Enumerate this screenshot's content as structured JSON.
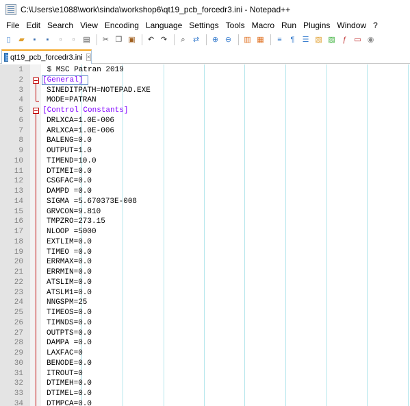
{
  "window": {
    "title": "C:\\Users\\e1088\\work\\sinda\\workshop6\\qt19_pcb_forcedr3.ini - Notepad++"
  },
  "menu": [
    "File",
    "Edit",
    "Search",
    "View",
    "Encoding",
    "Language",
    "Settings",
    "Tools",
    "Macro",
    "Run",
    "Plugins",
    "Window",
    "?"
  ],
  "toolbar": {
    "buttons": [
      {
        "name": "new-file-icon",
        "glyph": "▯",
        "color": "#3b7fcf"
      },
      {
        "name": "open-file-icon",
        "glyph": "▰",
        "color": "#e0a030"
      },
      {
        "name": "save-icon",
        "glyph": "▪",
        "color": "#3b6fb0"
      },
      {
        "name": "save-all-icon",
        "glyph": "▪",
        "color": "#3b6fb0"
      },
      {
        "name": "close-icon",
        "glyph": "▫",
        "color": "#888888"
      },
      {
        "name": "close-all-icon",
        "glyph": "▫",
        "color": "#888888"
      },
      {
        "name": "print-icon",
        "glyph": "▤",
        "color": "#555555"
      },
      {
        "sep": true
      },
      {
        "name": "cut-icon",
        "glyph": "✂",
        "color": "#555555"
      },
      {
        "name": "copy-icon",
        "glyph": "❐",
        "color": "#555555"
      },
      {
        "name": "paste-icon",
        "glyph": "▣",
        "color": "#a06020"
      },
      {
        "sep": true
      },
      {
        "name": "undo-icon",
        "glyph": "↶",
        "color": "#333333"
      },
      {
        "name": "redo-icon",
        "glyph": "↷",
        "color": "#333333"
      },
      {
        "sep": true
      },
      {
        "name": "find-icon",
        "glyph": "⌕",
        "color": "#333333"
      },
      {
        "name": "replace-icon",
        "glyph": "⇄",
        "color": "#3b7fcf"
      },
      {
        "sep": true
      },
      {
        "name": "zoom-in-icon",
        "glyph": "⊕",
        "color": "#3b7fcf"
      },
      {
        "name": "zoom-out-icon",
        "glyph": "⊖",
        "color": "#3b7fcf"
      },
      {
        "sep": true
      },
      {
        "name": "sync-vertical-icon",
        "glyph": "▥",
        "color": "#e07020"
      },
      {
        "name": "sync-horizontal-icon",
        "glyph": "▦",
        "color": "#e07020"
      },
      {
        "sep": true
      },
      {
        "name": "word-wrap-icon",
        "glyph": "≡",
        "color": "#3b7fcf"
      },
      {
        "name": "show-all-chars-icon",
        "glyph": "¶",
        "color": "#3b7fcf"
      },
      {
        "name": "indent-guide-icon",
        "glyph": "☰",
        "color": "#3b7fcf"
      },
      {
        "name": "language-udl-icon",
        "glyph": "▧",
        "color": "#e0a030"
      },
      {
        "name": "document-map-icon",
        "glyph": "▨",
        "color": "#3bb03b"
      },
      {
        "name": "function-list-icon",
        "glyph": "ƒ",
        "color": "#c03030"
      },
      {
        "name": "folder-workspace-icon",
        "glyph": "▭",
        "color": "#c03030"
      },
      {
        "name": "monitoring-icon",
        "glyph": "◉",
        "color": "#888888"
      }
    ]
  },
  "tab": {
    "label": "qt19_pcb_forcedr3.ini",
    "close": "×"
  },
  "editor": {
    "lines": [
      {
        "n": "1",
        "text": " $ MSC Patran 2019",
        "type": "plain"
      },
      {
        "n": "2",
        "text": "[General]",
        "type": "section"
      },
      {
        "n": "3",
        "text": "SINEDITPATH=NOTEPAD.EXE",
        "type": "kv"
      },
      {
        "n": "4",
        "text": "MODE=PATRAN",
        "type": "kv"
      },
      {
        "n": "5",
        "text": "[Control Constants]",
        "type": "section"
      },
      {
        "n": "6",
        "text": "DRLXCA=1.0E-006",
        "type": "kv"
      },
      {
        "n": "7",
        "text": "ARLXCA=1.0E-006",
        "type": "kv"
      },
      {
        "n": "8",
        "text": "BALENG=0.0",
        "type": "kv"
      },
      {
        "n": "9",
        "text": "OUTPUT=1.0",
        "type": "kv"
      },
      {
        "n": "10",
        "text": "TIMEND=10.0",
        "type": "kv"
      },
      {
        "n": "11",
        "text": "DTIMEI=0.0",
        "type": "kv"
      },
      {
        "n": "12",
        "text": "CSGFAC=0.0",
        "type": "kv"
      },
      {
        "n": "13",
        "text": "DAMPD =0.0",
        "type": "kv"
      },
      {
        "n": "14",
        "text": "SIGMA =5.670373E-008",
        "type": "kv"
      },
      {
        "n": "15",
        "text": "GRVCON=9.810",
        "type": "kv"
      },
      {
        "n": "16",
        "text": "TMPZRO=273.15",
        "type": "kv"
      },
      {
        "n": "17",
        "text": "NLOOP =5000",
        "type": "kv"
      },
      {
        "n": "18",
        "text": "EXTLIM=0.0",
        "type": "kv"
      },
      {
        "n": "19",
        "text": "TIMEO =0.0",
        "type": "kv"
      },
      {
        "n": "20",
        "text": "ERRMAX=0.0",
        "type": "kv"
      },
      {
        "n": "21",
        "text": "ERRMIN=0.0",
        "type": "kv"
      },
      {
        "n": "22",
        "text": "ATSLIM=0.0",
        "type": "kv"
      },
      {
        "n": "23",
        "text": "ATSLM1=0.0",
        "type": "kv"
      },
      {
        "n": "24",
        "text": "NNGSPM=25",
        "type": "kv"
      },
      {
        "n": "25",
        "text": "TIMEOS=0.0",
        "type": "kv"
      },
      {
        "n": "26",
        "text": "TIMNDS=0.0",
        "type": "kv"
      },
      {
        "n": "27",
        "text": "OUTPTS=0.0",
        "type": "kv"
      },
      {
        "n": "28",
        "text": "DAMPA =0.0",
        "type": "kv"
      },
      {
        "n": "29",
        "text": "LAXFAC=0",
        "type": "kv"
      },
      {
        "n": "30",
        "text": "BENODE=0.0",
        "type": "kv"
      },
      {
        "n": "31",
        "text": "ITROUT=0",
        "type": "kv"
      },
      {
        "n": "32",
        "text": "DTIMEH=0.0",
        "type": "kv"
      },
      {
        "n": "33",
        "text": "DTIMEL=0.0",
        "type": "kv"
      },
      {
        "n": "34",
        "text": "DTMPCA=0.0",
        "type": "kv"
      }
    ]
  }
}
